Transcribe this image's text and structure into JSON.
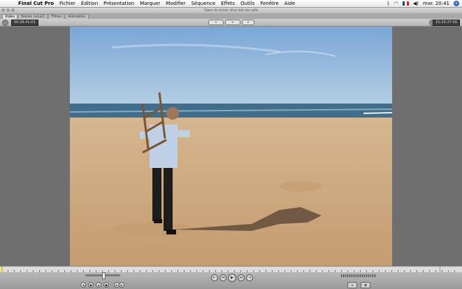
{
  "menubar": {
    "app_name": "Final Cut Pro",
    "items": [
      "Fichier",
      "Édition",
      "Présentation",
      "Marquer",
      "Modifier",
      "Séquence",
      "Effets",
      "Outils",
      "Fenêtre",
      "Aide"
    ],
    "clock": "mar. 20:41"
  },
  "window": {
    "title": "Dans le miroir d'un bol de café"
  },
  "tabs": [
    "Vidéo",
    "Stéréo (a1a2)",
    "Filtres",
    "Animation"
  ],
  "viewer": {
    "timecode_left": "00:28:41:03",
    "timecode_right": "01:25:37:00"
  },
  "colors": {
    "sky_top": "#7ea9d6",
    "sea": "#3e6f8e",
    "sand": "#c9a67c",
    "chrome": "#6f6f6f"
  }
}
